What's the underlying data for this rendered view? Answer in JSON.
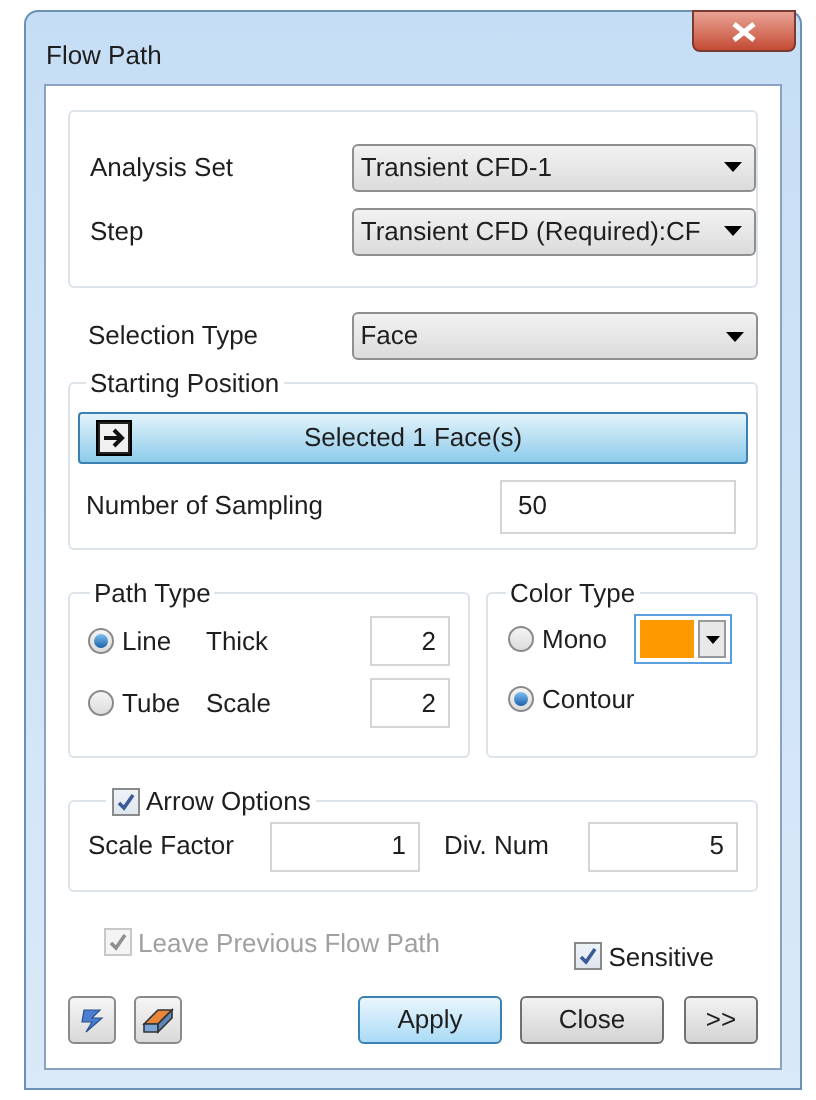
{
  "window": {
    "title": "Flow Path"
  },
  "analysis": {
    "fields": [
      {
        "label": "Analysis Set",
        "value": "Transient CFD-1"
      },
      {
        "label": "Step",
        "value": "Transient CFD (Required):CF"
      }
    ]
  },
  "selection_type": {
    "label": "Selection Type",
    "value": "Face"
  },
  "starting_position": {
    "title": "Starting Position",
    "button": "Selected 1 Face(s)",
    "sampling_label": "Number of Sampling",
    "sampling_value": "50"
  },
  "path_type": {
    "title": "Path Type",
    "options": [
      {
        "label": "Line",
        "selected": true,
        "param_label": "Thick",
        "param_value": "2"
      },
      {
        "label": "Tube",
        "selected": false,
        "param_label": "Scale",
        "param_value": "2"
      }
    ]
  },
  "color_type": {
    "title": "Color Type",
    "color": "#ff9900",
    "options": [
      {
        "label": "Mono",
        "selected": false
      },
      {
        "label": "Contour",
        "selected": true
      }
    ]
  },
  "arrow_options": {
    "label": "Arrow Options",
    "checked": true,
    "scale_label": "Scale Factor",
    "scale_value": "1",
    "div_label": "Div. Num",
    "div_value": "5"
  },
  "leave_previous": {
    "label": "Leave Previous Flow Path",
    "checked": true,
    "disabled": true
  },
  "sensitive": {
    "label": "Sensitive",
    "checked": true,
    "disabled": false
  },
  "buttons": [
    {
      "label": "Apply",
      "selected": true
    },
    {
      "label": "Close",
      "selected": false
    },
    {
      "label": ">>",
      "selected": false
    }
  ]
}
